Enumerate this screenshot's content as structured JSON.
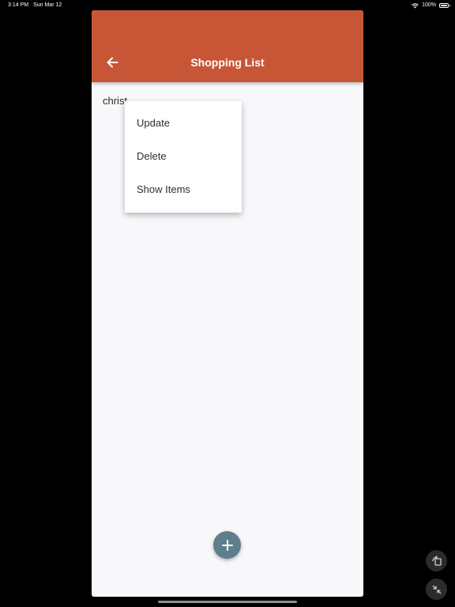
{
  "status_bar": {
    "time": "3:14 PM",
    "date": "Sun Mar 12",
    "battery": "100%"
  },
  "app_bar": {
    "title": "Shopping List",
    "back_icon": "arrow-back-icon"
  },
  "list": {
    "items": [
      {
        "label": "christ"
      }
    ]
  },
  "popup_menu": {
    "items": [
      {
        "label": "Update"
      },
      {
        "label": "Delete"
      },
      {
        "label": "Show Items"
      }
    ]
  },
  "fab": {
    "icon": "plus-icon"
  },
  "side_controls": {
    "rotate_icon": "rotate-screen-icon",
    "shrink_icon": "shrink-window-icon"
  },
  "colors": {
    "app_bar": "#c75637",
    "fab": "#5f7e8c",
    "background": "#f8f7fa"
  }
}
